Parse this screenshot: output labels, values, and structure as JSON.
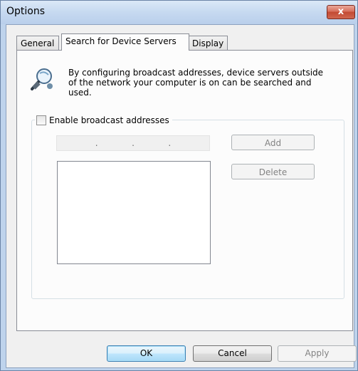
{
  "window": {
    "title": "Options",
    "close_label": "x"
  },
  "tabs": [
    {
      "label": "General",
      "active": false
    },
    {
      "label": "Search for Device Servers",
      "active": true
    },
    {
      "label": "Display",
      "active": false
    }
  ],
  "search_tab": {
    "icon": "network-search-icon",
    "description": "By configuring broadcast addresses, device servers outside of the network your computer is on can be searched and used.",
    "enable_broadcast": {
      "label": "Enable broadcast addresses",
      "checked": false
    },
    "ip_address": {
      "separator": "."
    },
    "add_label": "Add",
    "delete_label": "Delete"
  },
  "footer": {
    "ok_label": "OK",
    "cancel_label": "Cancel",
    "apply_label": "Apply"
  }
}
